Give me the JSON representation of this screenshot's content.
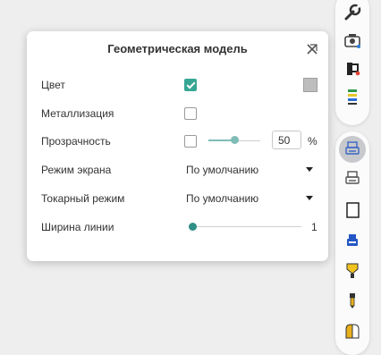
{
  "dialog": {
    "title": "Геометрическая модель",
    "rows": {
      "color": {
        "label": "Цвет",
        "checked": true,
        "swatch_color": "#bdbdbd"
      },
      "metallic": {
        "label": "Металлизация",
        "checked": false
      },
      "transparency": {
        "label": "Прозрачность",
        "checked": false,
        "value": "50",
        "unit": "%",
        "slider_fraction": 0.5
      },
      "screen_mode": {
        "label": "Режим экрана",
        "value": "По умолчанию"
      },
      "lathe_mode": {
        "label": "Токарный режим",
        "value": "По умолчанию"
      },
      "line_width": {
        "label": "Ширина линии",
        "value": "1",
        "slider_fraction": 0
      }
    }
  },
  "colors": {
    "accent": "#37a694",
    "slider_transparency": "#7fbcb6",
    "slider_width": "#2f8f86"
  },
  "toolbar": {
    "top": [
      "wrench-icon",
      "camera-zoom-icon",
      "split-shape-icon",
      "layers-icon"
    ],
    "bottom": [
      "printer-blue-icon",
      "printer-gray-icon",
      "blank-page-icon",
      "blue-device-icon",
      "yellow-shield-icon",
      "tool-holder-icon",
      "colored-bins-icon"
    ]
  }
}
